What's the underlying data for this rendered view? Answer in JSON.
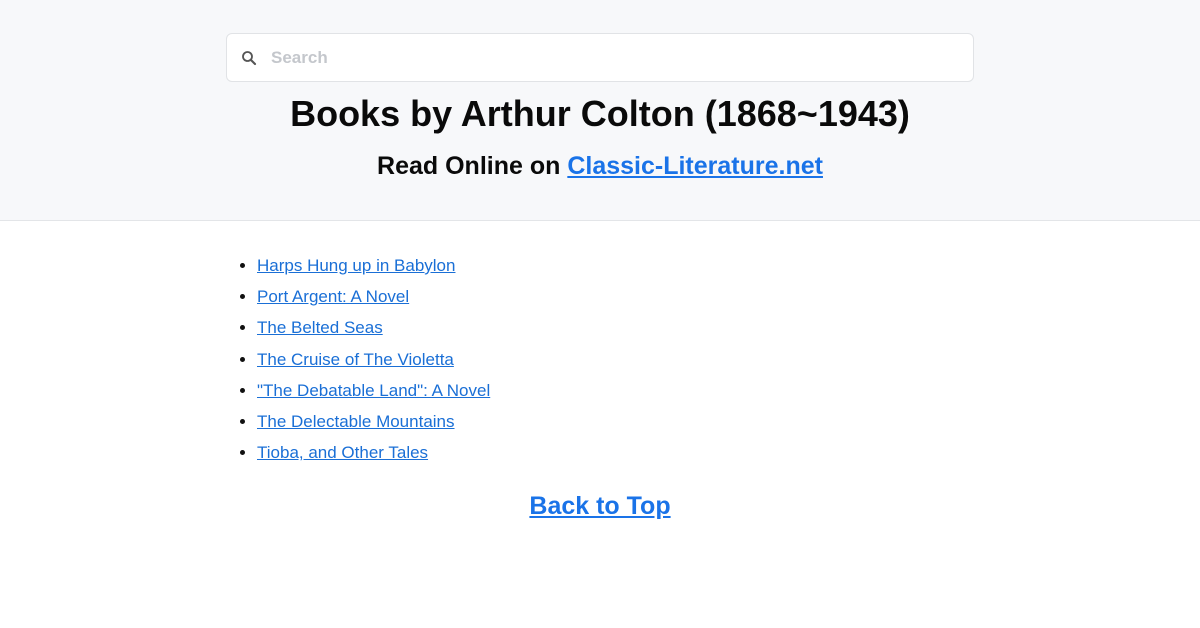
{
  "search": {
    "placeholder": "Search",
    "icon": "search-icon"
  },
  "header": {
    "title": "Books by Arthur Colton (1868~1943)",
    "subtitle_prefix": "Read Online on ",
    "site_link": "Classic-Literature.net"
  },
  "books": [
    "Harps Hung up in Babylon",
    "Port Argent: A Novel",
    "The Belted Seas",
    "The Cruise of The Violetta",
    "\"The Debatable Land\": A Novel",
    "The Delectable Mountains",
    "Tioba, and Other Tales"
  ],
  "footer": {
    "back_to_top": "Back to Top"
  },
  "colors": {
    "link": "#1a73e8",
    "header_bg": "#f7f8fa"
  }
}
